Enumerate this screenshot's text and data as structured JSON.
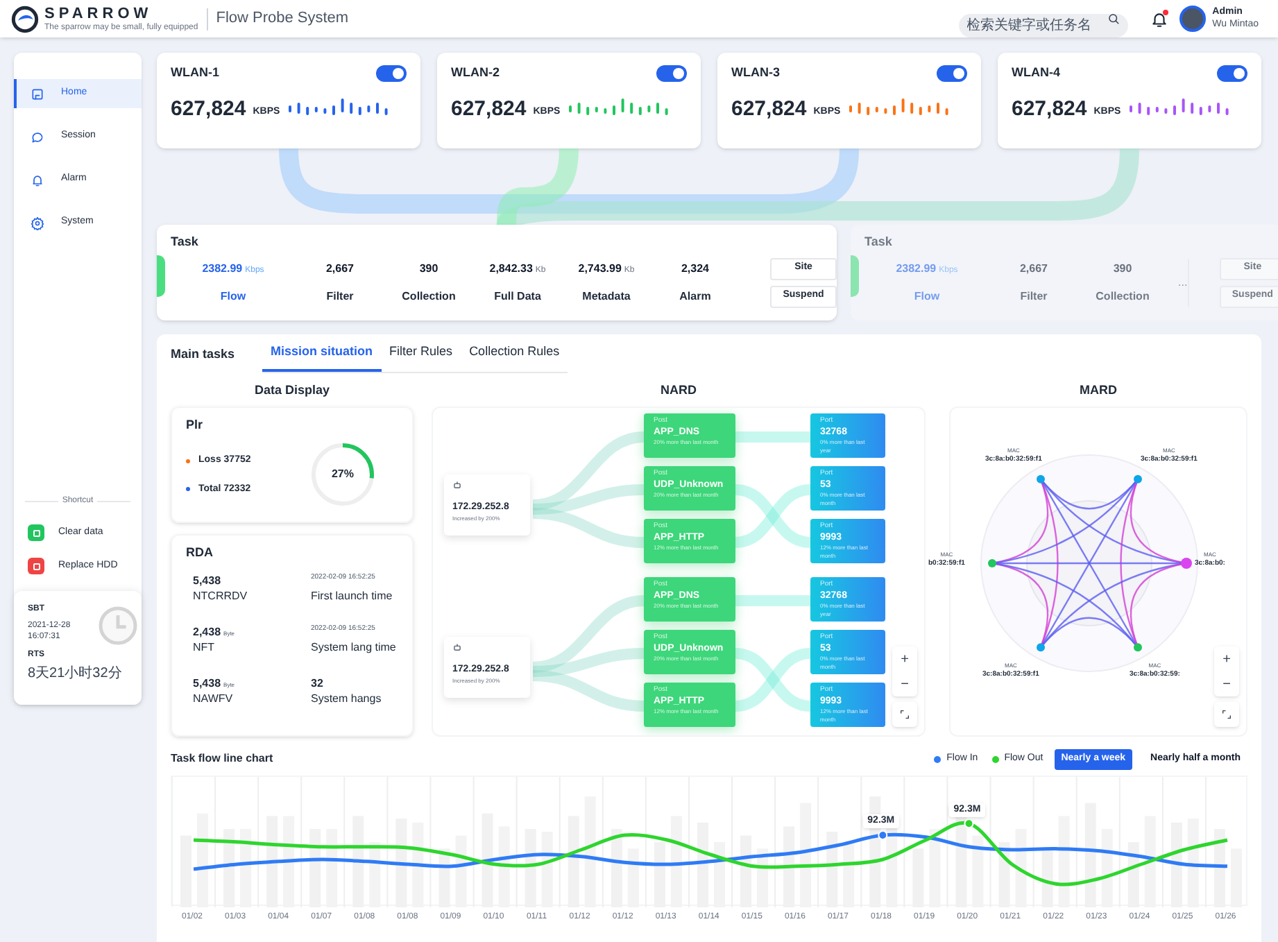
{
  "header": {
    "logo": {
      "name": "SPARROW",
      "tagline": "The sparrow may be small, fully equipped"
    },
    "title": "Flow Probe System",
    "search": {
      "placeholder": "检索关键字或任务名"
    },
    "unread": true,
    "user": {
      "role": "Admin",
      "name": "Wu Mintao"
    }
  },
  "sidebar": {
    "items": [
      {
        "label": "Home",
        "selected": true
      },
      {
        "label": "Session",
        "selected": false
      },
      {
        "label": "Alarm",
        "selected": false
      },
      {
        "label": "System",
        "selected": false
      }
    ],
    "shortcut": {
      "title": "Shortcut",
      "items": [
        {
          "label": "Clear data",
          "color": "#22c55e"
        },
        {
          "label": "Replace HDD",
          "color": "#ef4444"
        }
      ]
    },
    "times": [
      {
        "label": "SBT",
        "value": "2021-12-28 16:07:31"
      },
      {
        "label": "RTS",
        "value": "8天21小时32分"
      }
    ]
  },
  "wlan": [
    {
      "name": "WLAN-1",
      "on": true,
      "value": "627,824",
      "unit": "KBPS",
      "color": "#2563eb"
    },
    {
      "name": "WLAN-2",
      "on": true,
      "value": "627,824",
      "unit": "KBPS",
      "color": "#22c55e"
    },
    {
      "name": "WLAN-3",
      "on": true,
      "value": "627,824",
      "unit": "KBPS",
      "color": "#f97316"
    },
    {
      "name": "WLAN-4",
      "on": true,
      "value": "627,824",
      "unit": "KBPS",
      "color": "#a855f7"
    }
  ],
  "tasks": [
    {
      "title": "Task",
      "faded": false,
      "stats": [
        {
          "value": "2382.99",
          "unit": "Kbps",
          "label": "Flow",
          "highlight": true
        },
        {
          "value": "2,667",
          "label": "Filter",
          "highlight": false
        },
        {
          "value": "390",
          "label": "Collection",
          "highlight": false
        },
        {
          "value": "2,842.33",
          "unit": "Kb",
          "label": "Full Data",
          "highlight": false
        },
        {
          "value": "2,743.99",
          "unit": "Kb",
          "label": "Metadata",
          "highlight": false
        },
        {
          "value": "2,324",
          "label": "Alarm",
          "highlight": false
        }
      ],
      "buttons": [
        "Site",
        "Suspend"
      ]
    },
    {
      "title": "Task",
      "faded": true,
      "stats": [
        {
          "value": "2382.99",
          "unit": "Kbps",
          "label": "Flow",
          "highlight": true
        },
        {
          "value": "2,667",
          "label": "Filter",
          "highlight": false
        },
        {
          "value": "390",
          "label": "Collection",
          "highlight": false
        }
      ],
      "more": "...",
      "buttons": [
        "Site",
        "Suspend"
      ]
    }
  ],
  "main": {
    "title": "Main tasks",
    "tabs": [
      {
        "label": "Mission situation",
        "selected": true
      },
      {
        "label": "Filter Rules",
        "selected": false
      },
      {
        "label": "Collection Rules",
        "selected": false
      }
    ]
  },
  "data_display": {
    "title": "Data Display",
    "plr": {
      "title": "Plr",
      "items": [
        {
          "label": "Loss 37752",
          "color": "#f97316"
        },
        {
          "label": "Total 72332",
          "color": "#2563eb"
        }
      ],
      "ring": {
        "label": "27%",
        "level": 0.27
      }
    },
    "rda": {
      "title": "RDA",
      "items": [
        {
          "kind": "number",
          "value": "5,438",
          "label": "NTCRRDV"
        },
        {
          "kind": "date",
          "value": "2022-02-09 16:52:25",
          "label": "First launch time"
        },
        {
          "kind": "number",
          "value": "2,438",
          "unit": "Byte",
          "label": "NFT"
        },
        {
          "kind": "date",
          "value": "2022-02-09 16:52:25",
          "label": "System lang time"
        },
        {
          "kind": "number",
          "value": "5,438",
          "unit": "Byte",
          "label": "NAWFV"
        },
        {
          "kind": "number",
          "value": "32",
          "label": "System hangs"
        }
      ]
    }
  },
  "nard": {
    "title": "NARD",
    "sources": [
      {
        "address": "172.29.252.8",
        "note": "Increased by 200%"
      },
      {
        "address": "172.29.252.8",
        "note": "Increased by 200%"
      }
    ],
    "apps": [
      {
        "caption": "Post",
        "name": "APP_DNS",
        "note": "20% more than last month"
      },
      {
        "caption": "Post",
        "name": "UDP_Unknown",
        "note": "20% more than last month"
      },
      {
        "caption": "Post",
        "name": "APP_HTTP",
        "note": "12% more than last month"
      },
      {
        "caption": "Post",
        "name": "APP_DNS",
        "note": "20% more than last month"
      },
      {
        "caption": "Post",
        "name": "UDP_Unknown",
        "note": "20% more than last month"
      },
      {
        "caption": "Post",
        "name": "APP_HTTP",
        "note": "12% more than last month"
      }
    ],
    "ports": [
      {
        "caption": "Port",
        "name": "32768",
        "note": "0% more than last year"
      },
      {
        "caption": "Port",
        "name": "53",
        "note": "0% more than last month"
      },
      {
        "caption": "Port",
        "name": "9993",
        "note": "12% more than last month"
      },
      {
        "caption": "Port",
        "name": "32768",
        "note": "0% more than last year"
      },
      {
        "caption": "Port",
        "name": "53",
        "note": "0% more than last month"
      },
      {
        "caption": "Port",
        "name": "9993",
        "note": "12% more than last month"
      }
    ],
    "zoom": [
      "+",
      "−"
    ]
  },
  "mard": {
    "title": "MARD",
    "nodes": [
      {
        "caption": "MAC",
        "address": "3c:8a:b0:32:59:f1",
        "color": "#0ea5e9"
      },
      {
        "caption": "MAC",
        "address": "3c:8a:b0:32:59:f1",
        "color": "#0ea5e9"
      },
      {
        "caption": "MAC",
        "address": "b0:32:59:f1",
        "color": "#22c55e"
      },
      {
        "caption": "MAC",
        "address": "3c:8a:b0:",
        "color": "#d946ef"
      },
      {
        "caption": "MAC",
        "address": "3c:8a:b0:32:59:f1",
        "color": "#0ea5e9"
      },
      {
        "caption": "MAC",
        "address": "3c:8a:b0:32:59:",
        "color": "#22c55e"
      }
    ],
    "zoom": [
      "+",
      "−"
    ]
  },
  "chart": {
    "title": "Task flow line chart",
    "legend": [
      {
        "label": "Flow In",
        "color": "#2f7bf5",
        "peak_label": "92.3M"
      },
      {
        "label": "Flow Out",
        "color": "#2ed52e",
        "peak_label": "92.3M"
      }
    ],
    "ranges": [
      {
        "label": "Nearly a week",
        "selected": true
      },
      {
        "label": "Nearly half a month",
        "selected": false
      }
    ],
    "x_labels": [
      "01/02",
      "01/03",
      "01/04",
      "01/07",
      "01/08",
      "01/08",
      "01/09",
      "01/10",
      "01/11",
      "01/12",
      "01/12",
      "01/13",
      "01/14",
      "01/15",
      "01/16",
      "01/17",
      "01/18",
      "01/19",
      "01/20",
      "01/21",
      "01/22",
      "01/23",
      "01/24",
      "01/25",
      "01/26"
    ]
  }
}
